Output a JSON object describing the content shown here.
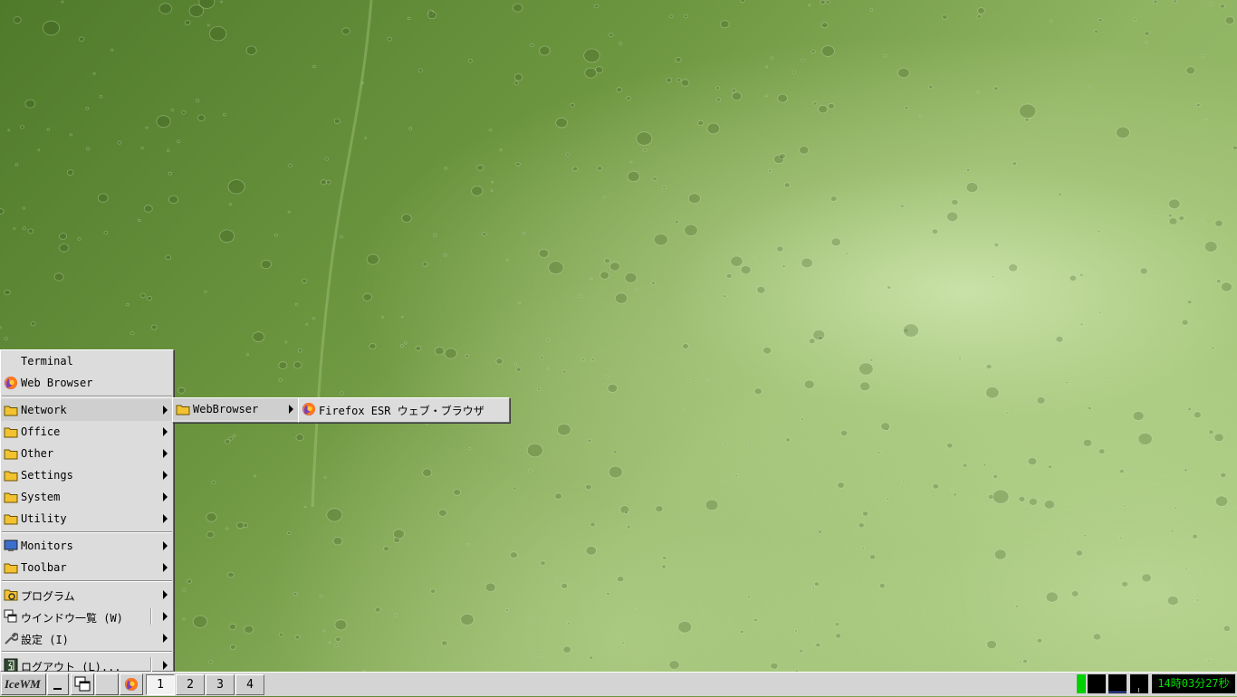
{
  "start_menu": {
    "items": [
      {
        "label": "Terminal",
        "icon": "none"
      },
      {
        "label": "Web Browser",
        "icon": "firefox-icon"
      },
      {
        "label": "Network",
        "icon": "folder-icon",
        "submenu": true
      },
      {
        "label": "Office",
        "icon": "folder-icon",
        "submenu": true
      },
      {
        "label": "Other",
        "icon": "folder-icon",
        "submenu": true
      },
      {
        "label": "Settings",
        "icon": "folder-icon",
        "submenu": true
      },
      {
        "label": "System",
        "icon": "folder-icon",
        "submenu": true
      },
      {
        "label": "Utility",
        "icon": "folder-icon",
        "submenu": true
      },
      {
        "label": "Monitors",
        "icon": "monitor-icon",
        "submenu": true
      },
      {
        "label": "Toolbar",
        "icon": "folder-icon",
        "submenu": true
      },
      {
        "label": "プログラム",
        "icon": "programs-icon",
        "submenu": true
      },
      {
        "label": "ウインドウ一覧 (W)",
        "icon": "window-list-icon",
        "submenu": true
      },
      {
        "label": "設定 (I)",
        "icon": "wrench-icon",
        "submenu": true
      },
      {
        "label": "ログアウト (L)...",
        "icon": "logout-icon",
        "submenu": true
      }
    ]
  },
  "network_submenu": {
    "items": [
      {
        "label": "WebBrowser",
        "icon": "folder-icon",
        "submenu": true
      }
    ]
  },
  "webbrowser_submenu": {
    "items": [
      {
        "label": "Firefox ESR ウェブ・ブラウザ",
        "icon": "firefox-icon"
      }
    ]
  },
  "taskbar": {
    "start_label": "IceWM",
    "workspaces": [
      "1",
      "2",
      "3",
      "4"
    ],
    "active_workspace": "1",
    "clock": "14時03分27秒"
  },
  "colors": {
    "menu_bg": "#dcdcdc",
    "folder": "#f2c230",
    "clock_text": "#00e000",
    "cpu_bar": "#00d000"
  }
}
